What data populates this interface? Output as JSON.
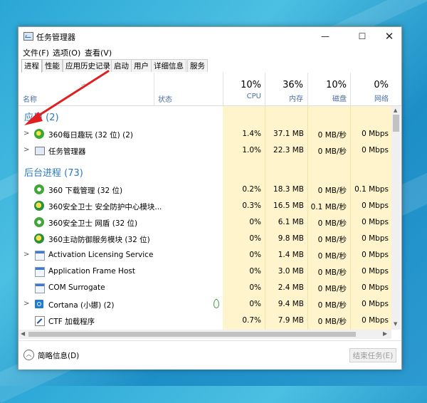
{
  "window": {
    "title": "任务管理器"
  },
  "menu": [
    "文件(F)",
    "选项(O)",
    "查看(V)"
  ],
  "tabs": [
    "进程",
    "性能",
    "应用历史记录",
    "启动",
    "用户",
    "详细信息",
    "服务"
  ],
  "header": {
    "name": "名称",
    "status": "状态",
    "cpu": {
      "pct": "10%",
      "label": "CPU"
    },
    "mem": {
      "pct": "36%",
      "label": "内存"
    },
    "disk": {
      "pct": "10%",
      "label": "磁盘"
    },
    "net": {
      "pct": "0%",
      "label": "网络"
    }
  },
  "groups": {
    "apps": "应用 (2)",
    "background": "后台进程 (73)"
  },
  "apps": [
    {
      "name": "360每日趣玩 (32 位) (2)",
      "cpu": "1.4%",
      "mem": "37.1 MB",
      "disk": "0 MB/秒",
      "net": "0 Mbps",
      "icon": "360-icon"
    },
    {
      "name": "任务管理器",
      "cpu": "1.0%",
      "mem": "22.3 MB",
      "disk": "0 MB/秒",
      "net": "0 Mbps",
      "icon": "task-manager-icon"
    }
  ],
  "background": [
    {
      "name": "360 下载管理 (32 位)",
      "cpu": "0.2%",
      "mem": "18.3 MB",
      "disk": "0 MB/秒",
      "net": "0.1 Mbps",
      "icon": "360-download-icon"
    },
    {
      "name": "360安全卫士 安全防护中心模块...",
      "cpu": "0.3%",
      "mem": "16.5 MB",
      "disk": "0.1 MB/秒",
      "net": "0 Mbps",
      "icon": "360-icon"
    },
    {
      "name": "360安全卫士 网盾 (32 位)",
      "cpu": "0%",
      "mem": "6.1 MB",
      "disk": "0 MB/秒",
      "net": "0 Mbps",
      "icon": "360-shield-icon"
    },
    {
      "name": "360主动防御服务模块 (32 位)",
      "cpu": "0%",
      "mem": "9.8 MB",
      "disk": "0 MB/秒",
      "net": "0 Mbps",
      "icon": "360-icon"
    },
    {
      "name": "Activation Licensing Service",
      "cpu": "0%",
      "mem": "1.4 MB",
      "disk": "0 MB/秒",
      "net": "0 Mbps",
      "icon": "window-icon"
    },
    {
      "name": "Application Frame Host",
      "cpu": "0%",
      "mem": "3.0 MB",
      "disk": "0 MB/秒",
      "net": "0 Mbps",
      "icon": "window-icon"
    },
    {
      "name": "COM Surrogate",
      "cpu": "0%",
      "mem": "2.4 MB",
      "disk": "0 MB/秒",
      "net": "0 Mbps",
      "icon": "window-icon"
    },
    {
      "name": "Cortana (小娜) (2)",
      "cpu": "0%",
      "mem": "9.4 MB",
      "disk": "0 MB/秒",
      "net": "0 Mbps",
      "icon": "cortana-icon"
    },
    {
      "name": "CTF 加载程序",
      "cpu": "0.7%",
      "mem": "7.9 MB",
      "disk": "0 MB/秒",
      "net": "0 Mbps",
      "icon": "ctf-icon"
    }
  ],
  "footer": {
    "fewer_details": "简略信息(D)",
    "end_task": "结束任务(E)"
  },
  "colors": {
    "highlight": "#fff4cc",
    "group_title": "#2b78c2",
    "header_label": "#4a6f9f"
  }
}
